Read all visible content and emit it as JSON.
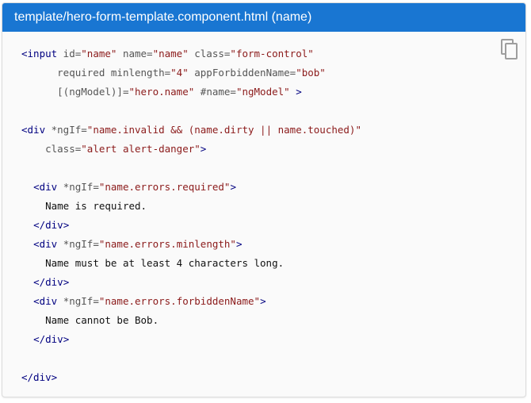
{
  "header": {
    "title": "template/hero-form-template.component.html (name)"
  },
  "copy_button": {
    "icon": "copy-icon"
  },
  "colors": {
    "header_bg": "#1976d2",
    "tag": "#000080",
    "string": "#8b1a1a"
  },
  "code": {
    "l1": {
      "open": "<input",
      "a1": " id=",
      "s1": "\"name\"",
      "a2": " name=",
      "s2": "\"name\"",
      "a3": " class=",
      "s3": "\"form-control\""
    },
    "l2": {
      "indent": "      ",
      "a1": "required minlength=",
      "s1": "\"4\"",
      "a2": " appForbiddenName=",
      "s2": "\"bob\""
    },
    "l3": {
      "indent": "      ",
      "a1": "[(ngModel)]=",
      "s1": "\"hero.name\"",
      "a2": " #name=",
      "s2": "\"ngModel\"",
      "close": " >"
    },
    "l5": {
      "open": "<div",
      "a1": " *ngIf=",
      "s1": "\"name.invalid && (name.dirty || name.touched)\""
    },
    "l6": {
      "indent": "    ",
      "a1": "class=",
      "s1": "\"alert alert-danger\"",
      "close": ">"
    },
    "l8": {
      "indent": "  ",
      "open": "<div",
      "a1": " *ngIf=",
      "s1": "\"name.errors.required\"",
      "close": ">"
    },
    "l9": {
      "indent": "    ",
      "text": "Name is required."
    },
    "l10": {
      "indent": "  ",
      "close": "</div>"
    },
    "l11": {
      "indent": "  ",
      "open": "<div",
      "a1": " *ngIf=",
      "s1": "\"name.errors.minlength\"",
      "close": ">"
    },
    "l12": {
      "indent": "    ",
      "text": "Name must be at least 4 characters long."
    },
    "l13": {
      "indent": "  ",
      "close": "</div>"
    },
    "l14": {
      "indent": "  ",
      "open": "<div",
      "a1": " *ngIf=",
      "s1": "\"name.errors.forbiddenName\"",
      "close": ">"
    },
    "l15": {
      "indent": "    ",
      "text": "Name cannot be Bob."
    },
    "l16": {
      "indent": "  ",
      "close": "</div>"
    },
    "l18": {
      "close": "</div>"
    }
  }
}
